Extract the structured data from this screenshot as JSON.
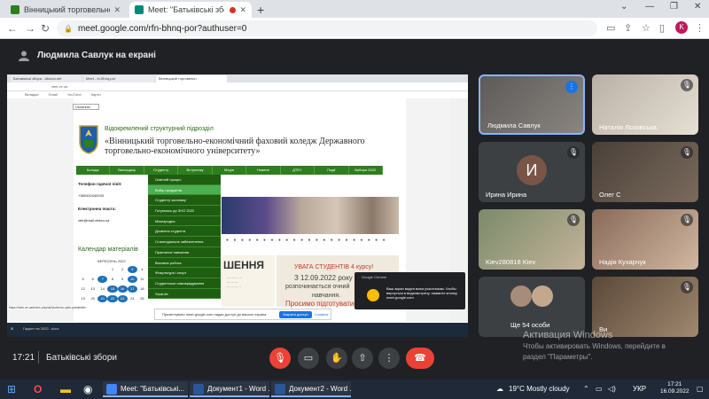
{
  "browser": {
    "tabs": [
      {
        "title": "Вінницький торговельно-економ",
        "active": false
      },
      {
        "title": "Meet: \"Батьківські збори\"",
        "active": true
      }
    ],
    "url": "meet.google.com/rfn-bhnq-por?authuser=0",
    "profile_letter": "K"
  },
  "meet": {
    "presenter_banner": "Людмила Савлук на екрані",
    "time": "17:21",
    "meeting_title": "Батьківські збори"
  },
  "shared_screen": {
    "tabs": [
      "Батьківські збори - Школа.net",
      "Meet - Ін-бhnq-por",
      "Вінницький торговельн"
    ],
    "url": "vtek.ve.ua",
    "bookmarks": [
      "Вкладки",
      "Gmail",
      "YouTube",
      "Карти"
    ],
    "language": "Ukrainian",
    "subtitle": "Відокремлений структурний підрозділ",
    "title": "«Вінницький торговельно-економічний фаховий коледж Державного торговельно-економічного університету»",
    "menu": [
      "Коледж",
      "Викладачу",
      "Студенту",
      "Вступнику",
      "Медіа",
      "Новини",
      "ДТЕУ",
      "Події",
      "Вибори 2022"
    ],
    "dropdown": [
      "Освітній процес",
      "Вибір предметів",
      "Студенту заочнику",
      "Готуємось до ЗНО 2022",
      "Міжнародна",
      "Дозвілля студента",
      "Стипендіальне забезпечення",
      "Практичне навчання",
      "Виховна робота",
      "Фізкультура і спорт",
      "Студентське самоврядування",
      "StudLife"
    ],
    "phone_label": "Телефон гарячої лінії:",
    "phone_value": "+380432440033",
    "email_label": "Електронна пошта:",
    "email_value": "vtet@mail.vtnteu.ua",
    "calendar_title": "Календар матеріалів",
    "calendar_month": "ВЕРЕСЕНЬ 2022",
    "calendar_days": [
      "",
      "",
      "",
      "1",
      "2",
      "3",
      "4",
      "5",
      "6",
      "7",
      "8",
      "9",
      "10",
      "11",
      "12",
      "13",
      "14",
      "15",
      "16",
      "17",
      "18",
      "19",
      "20",
      "21",
      "22",
      "23",
      "24",
      "25"
    ],
    "news_big": "ШЕННЯ",
    "news_right_1": "УВАГА СТУДЕНТІВ 4 курсу!",
    "news_right_2": "З 12.09.2022 року",
    "news_right_3": "розпочинається очний",
    "news_right_4": "навчання.",
    "news_right_5": "Просимо підготуватися!",
    "share_banner_text": "Презентувати meet.google.com надає доступ до вашого екрана",
    "share_stop": "Закрити доступ",
    "share_hide": "Сховати",
    "status_url": "https://vtek.ve.ua/index.php/uk/studentu-vybir-predmetiv",
    "taskbar_item": "Гаджет на 2022...docx",
    "notif_title": "Google Chrome",
    "notif_text": "Ваш экран виден всем участникам. Чтобы вернуться в видеовстречу, нажмите кнопку.",
    "notif_source": "meet.google.com"
  },
  "participants": [
    {
      "name": "Людмила Савлук",
      "highlighted": true,
      "mic": "active"
    },
    {
      "name": "Наталія Лозовська",
      "highlighted": false,
      "mic": "muted"
    },
    {
      "name": "Ирина Ирина",
      "highlighted": false,
      "mic": "muted",
      "letter": "И"
    },
    {
      "name": "Олег С",
      "highlighted": false,
      "mic": "muted"
    },
    {
      "name": "Kiev280818 Kiev",
      "highlighted": false,
      "mic": "muted"
    },
    {
      "name": "Надія Кухарчук",
      "highlighted": false,
      "mic": "muted"
    },
    {
      "name": "Ще 54 особи",
      "highlighted": false,
      "mic": "none"
    },
    {
      "name": "Ви",
      "highlighted": false,
      "mic": "muted"
    }
  ],
  "watermark": {
    "line1": "Активация Windows",
    "line2": "Чтобы активировать Windows, перейдите в",
    "line3": "раздел \"Параметры\"."
  },
  "taskbar": {
    "apps": [
      {
        "label": "Meet: \"Батьківські...",
        "color": "#4285f4"
      },
      {
        "label": "Документ1 - Word ...",
        "color": "#2b579a"
      },
      {
        "label": "Документ2 - Word ...",
        "color": "#2b579a"
      }
    ],
    "weather": "19°C  Mostly cloudy",
    "lang": "УКР",
    "clock_time": "17:21",
    "clock_date": "16.09.2022"
  }
}
